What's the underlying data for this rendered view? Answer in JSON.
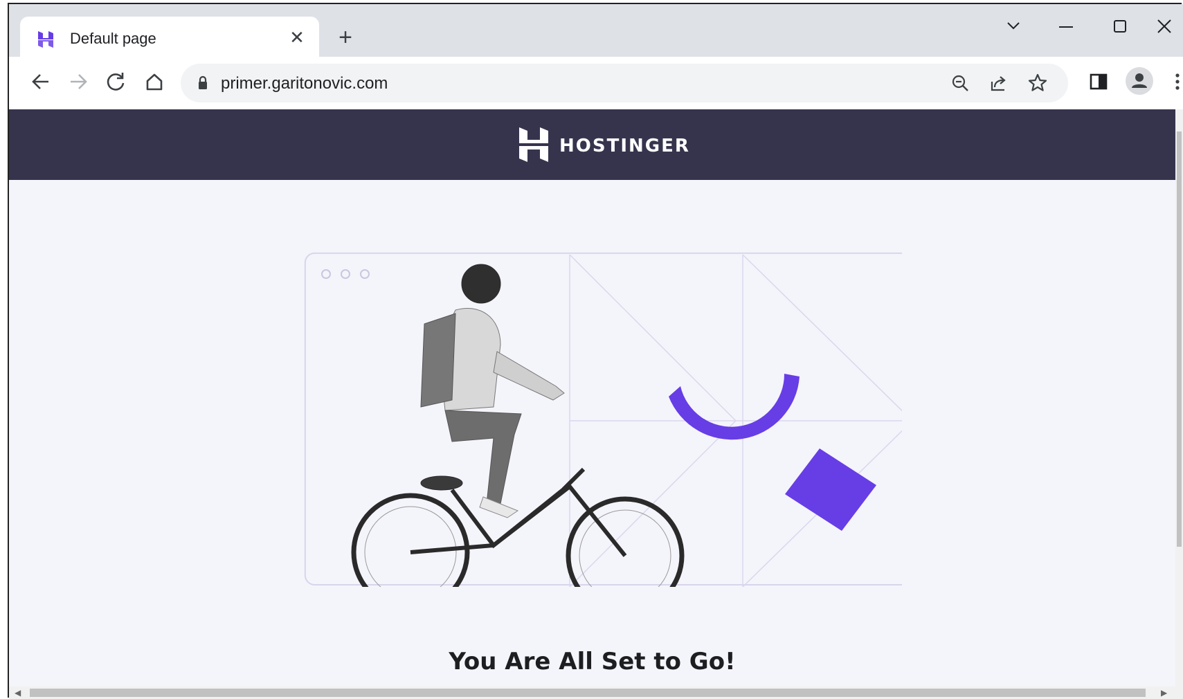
{
  "browser": {
    "tab": {
      "title": "Default page",
      "favicon": "hostinger-favicon",
      "close_glyph": "✕"
    },
    "new_tab_glyph": "+",
    "window_controls": [
      "chevron-down-icon",
      "minimize-icon",
      "maximize-icon",
      "close-icon"
    ],
    "nav_icons": [
      "back-icon",
      "forward-icon",
      "reload-icon",
      "home-icon"
    ],
    "url": "primer.garitonovic.com",
    "omnibox_icons": [
      "lock-icon",
      "zoom-out-icon",
      "share-icon",
      "star-icon"
    ],
    "toolbar_icons": [
      "side-panel-icon",
      "profile-icon",
      "menu-icon"
    ]
  },
  "page": {
    "brand": {
      "name": "HOSTINGER"
    },
    "headline": "You Are All Set to Go!"
  },
  "colors": {
    "header_bg": "#36344d",
    "accent": "#673de6",
    "page_bg": "#f4f4fb",
    "tabstrip_bg": "#dee1e6"
  }
}
